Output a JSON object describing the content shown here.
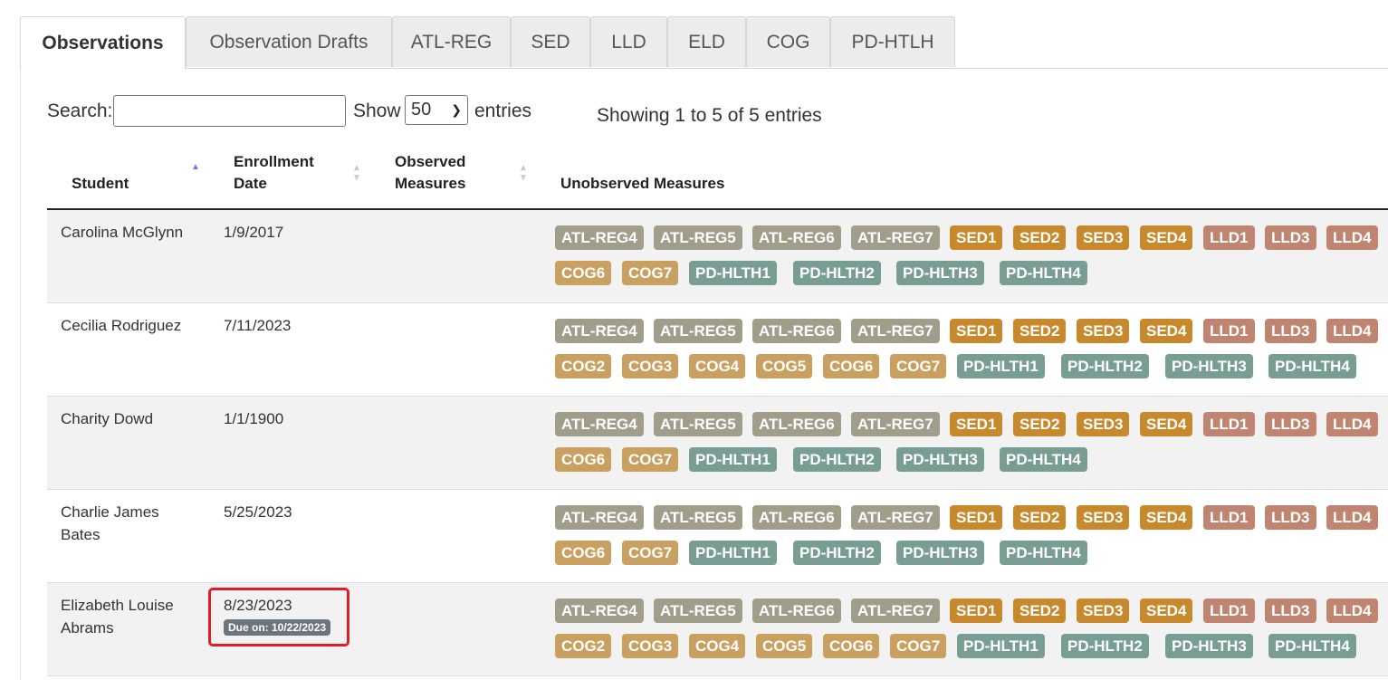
{
  "tabs": [
    {
      "label": "Observations",
      "active": true
    },
    {
      "label": "Observation Drafts",
      "active": false
    },
    {
      "label": "ATL-REG",
      "active": false
    },
    {
      "label": "SED",
      "active": false
    },
    {
      "label": "LLD",
      "active": false
    },
    {
      "label": "ELD",
      "active": false
    },
    {
      "label": "COG",
      "active": false
    },
    {
      "label": "PD-HTLH",
      "active": false
    }
  ],
  "toolbar": {
    "search_label": "Search:",
    "search_value": "",
    "show_label": "Show",
    "show_value": "50",
    "entries_label": "entries",
    "info": "Showing 1 to 5 of 5 entries"
  },
  "columns": {
    "student": "Student",
    "enrollment_line1": "Enrollment",
    "enrollment_line2": "Date",
    "observed_line1": "Observed",
    "observed_line2": "Measures",
    "unobserved": "Unobserved Measures"
  },
  "colors": {
    "ATL": "#a09e8b",
    "SED": "#c8892c",
    "LLD": "#c08570",
    "COG": "#c9a060",
    "PD": "#789e93",
    "highlight": "#e11d2a"
  },
  "rows": [
    {
      "name_line1": "Carolina McGlynn",
      "name_line2": "",
      "date": "1/9/2017",
      "due": "",
      "row1": [
        "ATL-REG4",
        "ATL-REG5",
        "ATL-REG6",
        "ATL-REG7",
        "SED1",
        "SED2",
        "SED3",
        "SED4",
        "LLD1",
        "LLD3",
        "LLD4"
      ],
      "row2": [
        "COG6",
        "COG7",
        "PD-HLTH1",
        "PD-HLTH2",
        "PD-HLTH3",
        "PD-HLTH4"
      ]
    },
    {
      "name_line1": "Cecilia Rodriguez",
      "name_line2": "",
      "date": "7/11/2023",
      "due": "",
      "row1": [
        "ATL-REG4",
        "ATL-REG5",
        "ATL-REG6",
        "ATL-REG7",
        "SED1",
        "SED2",
        "SED3",
        "SED4",
        "LLD1",
        "LLD3",
        "LLD4"
      ],
      "row2": [
        "COG2",
        "COG3",
        "COG4",
        "COG5",
        "COG6",
        "COG7",
        "PD-HLTH1",
        "PD-HLTH2",
        "PD-HLTH3",
        "PD-HLTH4"
      ]
    },
    {
      "name_line1": "Charity Dowd",
      "name_line2": "",
      "date": "1/1/1900",
      "due": "",
      "row1": [
        "ATL-REG4",
        "ATL-REG5",
        "ATL-REG6",
        "ATL-REG7",
        "SED1",
        "SED2",
        "SED3",
        "SED4",
        "LLD1",
        "LLD3",
        "LLD4"
      ],
      "row2": [
        "COG6",
        "COG7",
        "PD-HLTH1",
        "PD-HLTH2",
        "PD-HLTH3",
        "PD-HLTH4"
      ]
    },
    {
      "name_line1": "Charlie James",
      "name_line2": "Bates",
      "date": "5/25/2023",
      "due": "",
      "row1": [
        "ATL-REG4",
        "ATL-REG5",
        "ATL-REG6",
        "ATL-REG7",
        "SED1",
        "SED2",
        "SED3",
        "SED4",
        "LLD1",
        "LLD3",
        "LLD4"
      ],
      "row2": [
        "COG6",
        "COG7",
        "PD-HLTH1",
        "PD-HLTH2",
        "PD-HLTH3",
        "PD-HLTH4"
      ]
    },
    {
      "name_line1": "Elizabeth Louise",
      "name_line2": "Abrams",
      "date": "8/23/2023",
      "due": "Due on: 10/22/2023",
      "row1": [
        "ATL-REG4",
        "ATL-REG5",
        "ATL-REG6",
        "ATL-REG7",
        "SED1",
        "SED2",
        "SED3",
        "SED4",
        "LLD1",
        "LLD3",
        "LLD4"
      ],
      "row2": [
        "COG2",
        "COG3",
        "COG4",
        "COG5",
        "COG6",
        "COG7",
        "PD-HLTH1",
        "PD-HLTH2",
        "PD-HLTH3",
        "PD-HLTH4"
      ]
    }
  ]
}
